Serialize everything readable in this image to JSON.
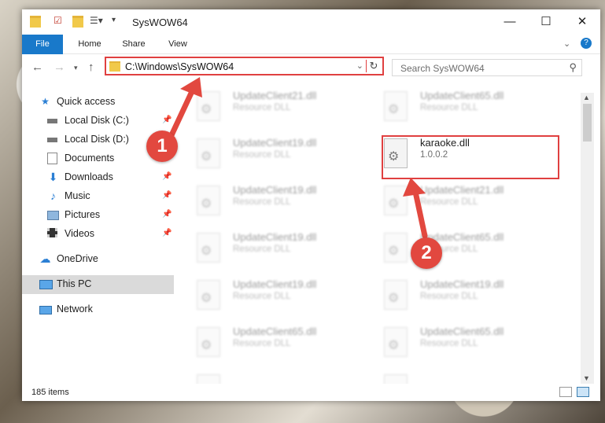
{
  "window": {
    "title": "SysWOW64"
  },
  "ribbon": {
    "tabs": [
      "File",
      "Home",
      "Share",
      "View"
    ]
  },
  "address": {
    "path": "C:\\Windows\\SysWOW64"
  },
  "search": {
    "placeholder": "Search SysWOW64"
  },
  "sidebar": {
    "items": [
      {
        "label": "Quick access",
        "icon": "star-icon"
      },
      {
        "label": "Local Disk (C:)",
        "icon": "drive-icon"
      },
      {
        "label": "Local Disk (D:)",
        "icon": "drive-icon"
      },
      {
        "label": "Documents",
        "icon": "documents-icon"
      },
      {
        "label": "Downloads",
        "icon": "download-icon"
      },
      {
        "label": "Music",
        "icon": "music-icon"
      },
      {
        "label": "Pictures",
        "icon": "pictures-icon"
      },
      {
        "label": "Videos",
        "icon": "videos-icon"
      },
      {
        "label": "OneDrive",
        "icon": "cloud-icon"
      },
      {
        "label": "This PC",
        "icon": "computer-icon"
      },
      {
        "label": "Network",
        "icon": "network-icon"
      }
    ]
  },
  "files": [
    {
      "name": "UpdateClient21.dll",
      "desc": "Resource DLL"
    },
    {
      "name": "UpdateClient65.dll",
      "desc": "Resource DLL"
    },
    {
      "name": "UpdateClient19.dll",
      "desc": "Resource DLL"
    },
    {
      "name": "karaoke.dll",
      "desc": "1.0.0.2"
    },
    {
      "name": "UpdateClient19.dll",
      "desc": "Resource DLL"
    },
    {
      "name": "UpdateClient21.dll",
      "desc": "Resource DLL"
    },
    {
      "name": "UpdateClient19.dll",
      "desc": "Resource DLL"
    },
    {
      "name": "UpdateClient65.dll",
      "desc": "Resource DLL"
    },
    {
      "name": "UpdateClient19.dll",
      "desc": "Resource DLL"
    },
    {
      "name": "UpdateClient19.dll",
      "desc": "Resource DLL"
    },
    {
      "name": "UpdateClient65.dll",
      "desc": "Resource DLL"
    },
    {
      "name": "UpdateClient65.dll",
      "desc": "Resource DLL"
    }
  ],
  "status": {
    "item_count": "185 items"
  },
  "annotations": {
    "step1": "1",
    "step2": "2"
  },
  "colors": {
    "accent": "#1979ca",
    "highlight": "#e04040"
  }
}
